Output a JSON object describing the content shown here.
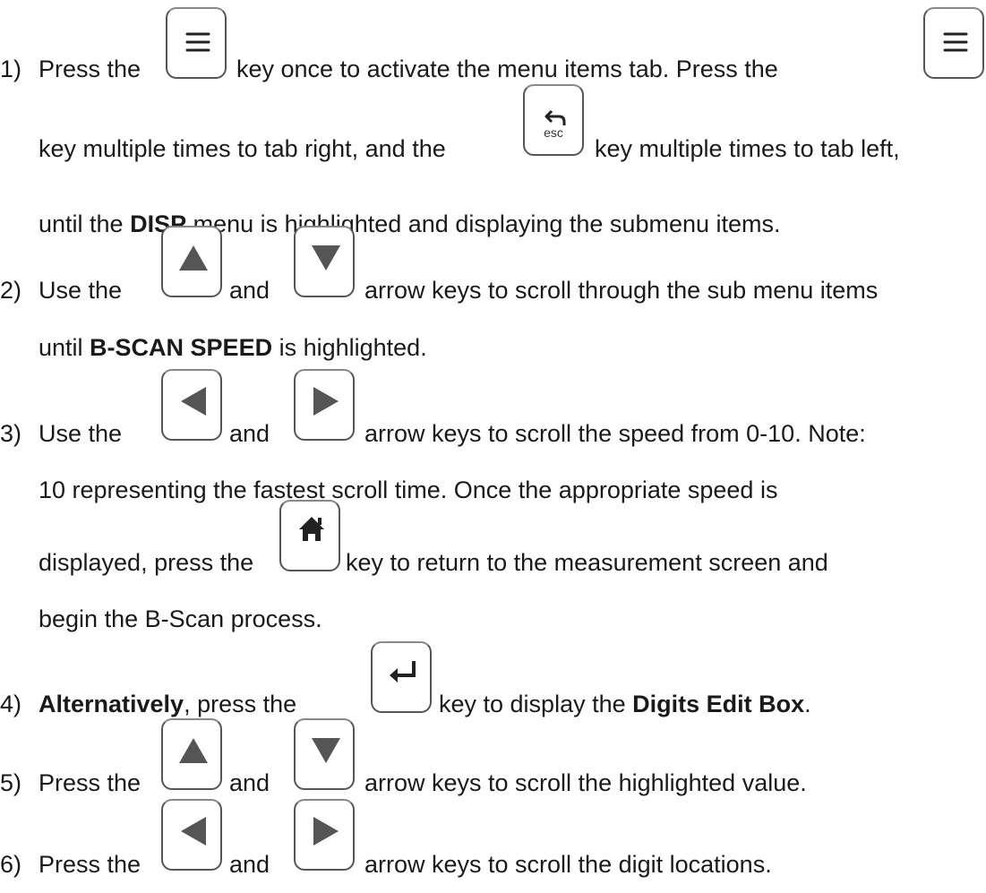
{
  "steps": [
    {
      "number": "1)",
      "lines": [
        {
          "a": "Press the",
          "b": "key once to activate the menu items tab.  Press the"
        },
        {
          "a": "key multiple times to tab right, and the",
          "b": "key multiple times to tab left,"
        },
        {
          "a": "until the ",
          "bold": "DISP",
          "b": " menu is highlighted and displaying the submenu items."
        }
      ]
    },
    {
      "number": "2)",
      "lines": [
        {
          "a": "Use the",
          "mid": "and",
          "b": "arrow keys to scroll through the sub menu items"
        },
        {
          "a": "until ",
          "bold": "B-SCAN SPEED",
          "b": " is highlighted."
        }
      ]
    },
    {
      "number": "3)",
      "lines": [
        {
          "a": "Use the",
          "mid": "and",
          "b": "arrow keys to scroll the speed from 0-10.  Note:"
        },
        {
          "a": "10 representing the fastest scroll time.  Once the appropriate speed is"
        },
        {
          "a": "displayed, press the",
          "b": "key to return to the measurement screen and"
        },
        {
          "a": "begin the B-Scan process."
        }
      ]
    },
    {
      "number": "4)",
      "lines": [
        {
          "bold": "Alternatively",
          "a": ", press the",
          "b": "key to display the ",
          "bold2": "Digits Edit Box",
          "c": "."
        }
      ]
    },
    {
      "number": "5)",
      "lines": [
        {
          "a": "Press the",
          "mid": "and",
          "b": "arrow keys to scroll the highlighted value."
        }
      ]
    },
    {
      "number": "6)",
      "lines": [
        {
          "a": "Press the",
          "mid": "and",
          "b": "arrow keys to scroll the digit locations."
        }
      ]
    }
  ],
  "keys": {
    "menu": "menu-key",
    "esc_label": "esc",
    "up": "up-arrow-key",
    "down": "down-arrow-key",
    "left": "left-arrow-key",
    "right": "right-arrow-key",
    "home": "home-key",
    "enter": "enter-key"
  }
}
